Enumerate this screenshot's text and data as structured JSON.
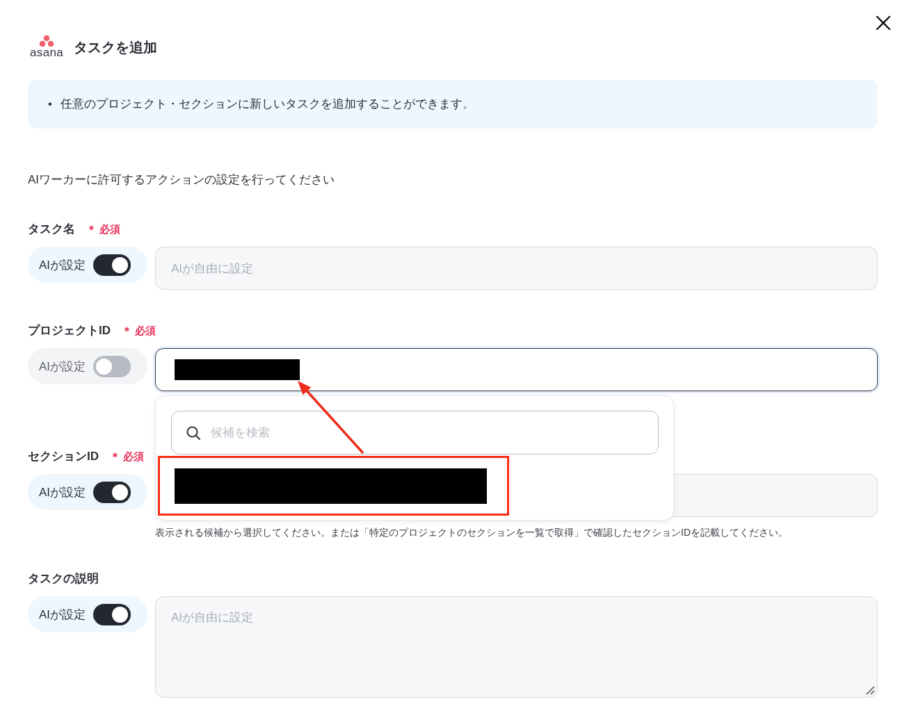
{
  "dialog": {
    "logo_text": "asana",
    "title": "タスクを追加"
  },
  "info": [
    {
      "bullet": "•",
      "text": "任意のプロジェクト・セクションに新しいタスクを追加することができます。"
    }
  ],
  "instruction": "AIワーカーに許可するアクションの設定を行ってください",
  "fields": [
    {
      "label": "タスク名",
      "required": true,
      "required_text": "＊ 必須",
      "toggle_label": "AIが設定",
      "ai_on": true,
      "kind": "input",
      "placeholder": "AIが自由に設定",
      "focused": false
    },
    {
      "label": "プロジェクトID",
      "required": true,
      "required_text": "＊ 必須",
      "toggle_label": "AIが設定",
      "ai_on": false,
      "kind": "input",
      "focused": true,
      "redacted": true,
      "dropdown": {
        "search_placeholder": "候補を検索",
        "options": [
          {
            "redacted": true,
            "highlighted": true
          }
        ]
      }
    },
    {
      "label": "セクションID",
      "required": true,
      "required_text": "＊ 必須",
      "toggle_label": "AIが設定",
      "ai_on": true,
      "kind": "input",
      "focused": false,
      "help": "表示される候補から選択してください。または「特定のプロジェクトのセクションを一覧で取得」で確認したセクションIDを記載してください。"
    },
    {
      "label": "タスクの説明",
      "required": false,
      "toggle_label": "AIが設定",
      "ai_on": true,
      "kind": "textarea",
      "placeholder": "AIが自由に設定",
      "focused": false
    }
  ]
}
